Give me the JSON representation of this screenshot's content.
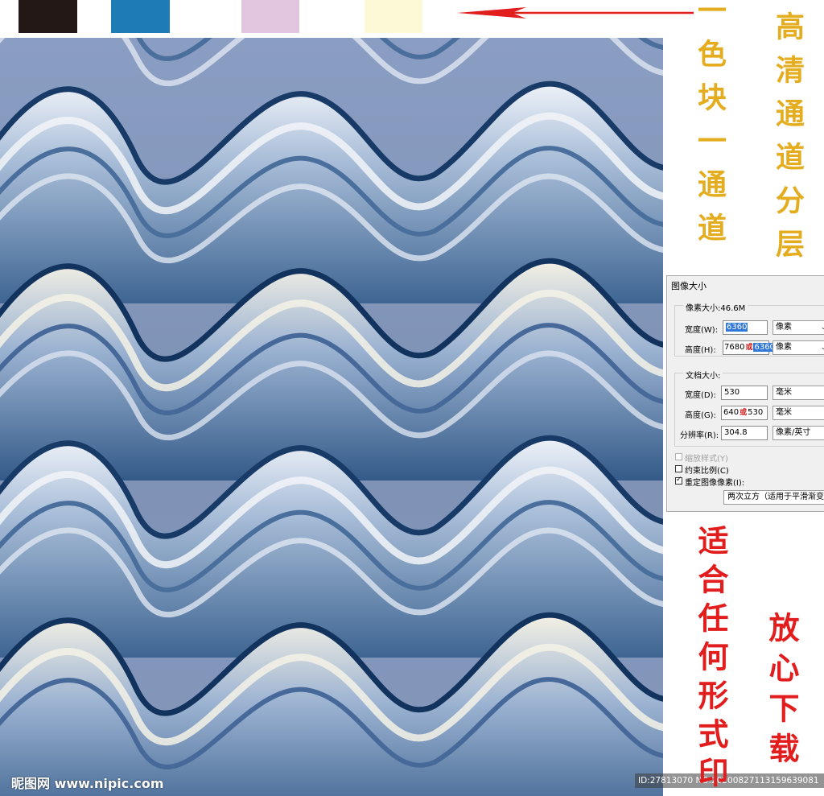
{
  "swatches": [
    "#231815",
    "#1f7bb6",
    "#e2c6df",
    "#fdf9d6"
  ],
  "accent_colors": {
    "gold_text": "#e4ad20",
    "red_text": "#e11d1d",
    "arrow": "#e11d1d"
  },
  "annotations": {
    "gold_left": "一色块一通道",
    "gold_right": "高清通道分层",
    "red_left": "适合任何形式印",
    "red_right": "放心下载"
  },
  "dialog": {
    "title": "图像大小",
    "pixel_group_label": "像素大小:46.6M",
    "width_label": "宽度(W):",
    "width_value": "6360",
    "height_label": "高度(H):",
    "height_value_old": "7680",
    "height_value_new": "6360",
    "pixel_unit": "像素",
    "doc_group_label": "文档大小:",
    "doc_width_label": "宽度(D):",
    "doc_width_value": "530",
    "doc_height_label": "高度(G):",
    "doc_height_value_old": "640",
    "doc_height_value_new": "530",
    "resolution_label": "分辨率(R):",
    "resolution_value": "304.8",
    "mm_unit": "毫米",
    "res_unit": "像素/英寸",
    "or_mark": "或",
    "scale_styles": "缩放样式(Y)",
    "constrain": "约束比例(C)",
    "resample": "重定图像像素(I):",
    "resample_method": "两次立方（适用于平滑渐变"
  },
  "watermark": {
    "site": "昵图网 www.nipic.com",
    "id": "ID:27813070 NO:20200827113159639081"
  }
}
